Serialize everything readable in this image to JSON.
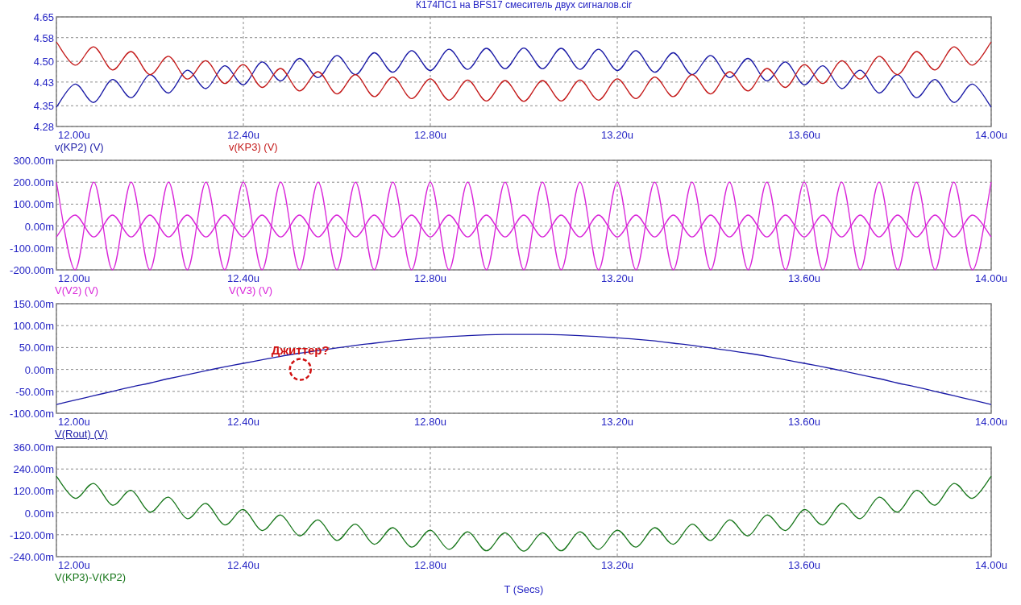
{
  "title": "К174ПС1 на BFS17 смеситель двух сигналов.cir",
  "panels": [
    {
      "chart_data": {
        "type": "line",
        "grid": true,
        "ylim": [
          4.28,
          4.65
        ],
        "xlim": [
          12,
          14
        ],
        "yticks": [
          {
            "value": 4.28,
            "label": "4.28"
          },
          {
            "value": 4.35,
            "label": "4.35"
          },
          {
            "value": 4.43,
            "label": "4.43"
          },
          {
            "value": 4.5,
            "label": "4.50"
          },
          {
            "value": 4.58,
            "label": "4.58"
          },
          {
            "value": 4.65,
            "label": "4.65"
          }
        ],
        "xticks": [
          {
            "value": 12,
            "label": "12.00u"
          },
          {
            "value": 12.4,
            "label": "12.40u"
          },
          {
            "value": 12.8,
            "label": "12.80u"
          },
          {
            "value": 13.2,
            "label": "13.20u"
          },
          {
            "value": 13.6,
            "label": "13.60u"
          },
          {
            "value": 14,
            "label": "14.00u"
          }
        ],
        "x": [
          12,
          12.04,
          12.08,
          12.12,
          12.16,
          12.2,
          12.24,
          12.28,
          12.32,
          12.36,
          12.4,
          12.44,
          12.48,
          12.52,
          12.56,
          12.6,
          12.64,
          12.68,
          12.72,
          12.76,
          12.8,
          12.84,
          12.88,
          12.92,
          12.96,
          13,
          13.04,
          13.08,
          13.12,
          13.16,
          13.2,
          13.24,
          13.28,
          13.32,
          13.36,
          13.4,
          13.44,
          13.48,
          13.52,
          13.56,
          13.6,
          13.64,
          13.68,
          13.72,
          13.76,
          13.8,
          13.84,
          13.88,
          13.92,
          13.96,
          14
        ],
        "series": [
          {
            "color": "#1a1aa6",
            "values": [
              4.345,
              4.423,
              4.361,
              4.439,
              4.377,
              4.455,
              4.393,
              4.47,
              4.408,
              4.485,
              4.421,
              4.498,
              4.434,
              4.51,
              4.445,
              4.52,
              4.455,
              4.529,
              4.463,
              4.536,
              4.469,
              4.541,
              4.473,
              4.544,
              4.475,
              4.545,
              4.475,
              4.544,
              4.473,
              4.541,
              4.469,
              4.536,
              4.463,
              4.529,
              4.455,
              4.52,
              4.445,
              4.51,
              4.434,
              4.498,
              4.421,
              4.485,
              4.408,
              4.47,
              4.393,
              4.455,
              4.377,
              4.439,
              4.361,
              4.423,
              4.345
            ]
          },
          {
            "color": "#c41a1a",
            "values": [
              4.565,
              4.487,
              4.549,
              4.471,
              4.533,
              4.455,
              4.517,
              4.44,
              4.502,
              4.425,
              4.489,
              4.412,
              4.476,
              4.4,
              4.465,
              4.39,
              4.455,
              4.381,
              4.447,
              4.374,
              4.441,
              4.369,
              4.437,
              4.366,
              4.435,
              4.365,
              4.435,
              4.366,
              4.437,
              4.369,
              4.441,
              4.374,
              4.447,
              4.381,
              4.455,
              4.39,
              4.465,
              4.4,
              4.476,
              4.412,
              4.489,
              4.425,
              4.502,
              4.44,
              4.517,
              4.455,
              4.533,
              4.471,
              4.549,
              4.487,
              4.565
            ]
          }
        ]
      },
      "legend": [
        {
          "label": "v(KP2) (V)",
          "color": "#1a1aa6",
          "selected": false
        },
        {
          "label": "v(KP3) (V)",
          "color": "#c41a1a",
          "selected": false
        }
      ]
    },
    {
      "chart_data": {
        "type": "line",
        "grid": true,
        "ylim": [
          -200,
          300
        ],
        "xlim": [
          12,
          14
        ],
        "yticks": [
          {
            "value": -200,
            "label": "-200.00m"
          },
          {
            "value": -100,
            "label": "-100.00m"
          },
          {
            "value": 0,
            "label": "0.00m"
          },
          {
            "value": 100,
            "label": "100.00m"
          },
          {
            "value": 200,
            "label": "200.00m"
          },
          {
            "value": 300,
            "label": "300.00m"
          }
        ],
        "xticks": [
          {
            "value": 12,
            "label": "12.00u"
          },
          {
            "value": 12.4,
            "label": "12.40u"
          },
          {
            "value": 12.8,
            "label": "12.80u"
          },
          {
            "value": 13.2,
            "label": "13.20u"
          },
          {
            "value": 13.6,
            "label": "13.60u"
          },
          {
            "value": 14,
            "label": "14.00u"
          }
        ],
        "x": [
          12,
          12.04,
          12.08,
          12.12,
          12.16,
          12.2,
          12.24,
          12.28,
          12.32,
          12.36,
          12.4,
          12.44,
          12.48,
          12.52,
          12.56,
          12.6,
          12.64,
          12.68,
          12.72,
          12.76,
          12.8,
          12.84,
          12.88,
          12.92,
          12.96,
          13,
          13.04,
          13.08,
          13.12,
          13.16,
          13.2,
          13.24,
          13.28,
          13.32,
          13.36,
          13.4,
          13.44,
          13.48,
          13.52,
          13.56,
          13.6,
          13.64,
          13.68,
          13.72,
          13.76,
          13.8,
          13.84,
          13.88,
          13.92,
          13.96,
          14
        ],
        "series": [
          {
            "color": "#d925d9",
            "values": [
              200,
              -200,
              200,
              -200,
              200,
              -200,
              200,
              -200,
              200,
              -200,
              200,
              -200,
              200,
              -200,
              200,
              -200,
              200,
              -200,
              200,
              -200,
              200,
              -200,
              200,
              -200,
              200,
              -200,
              200,
              -200,
              200,
              -200,
              200,
              -200,
              200,
              -200,
              200,
              -200,
              200,
              -200,
              200,
              -200,
              200,
              -200,
              200,
              -200,
              200,
              -200,
              200,
              -200,
              200,
              -200,
              200
            ]
          },
          {
            "color": "#d925d9",
            "values": [
              -50,
              50,
              -50,
              50,
              -50,
              50,
              -50,
              50,
              -50,
              50,
              -50,
              50,
              -50,
              50,
              -50,
              50,
              -50,
              50,
              -50,
              50,
              -50,
              50,
              -50,
              50,
              -50,
              50,
              -50,
              50,
              -50,
              50,
              -50,
              50,
              -50,
              50,
              -50,
              50,
              -50,
              50,
              -50,
              50,
              -50,
              50,
              -50,
              50,
              -50,
              50,
              -50,
              50,
              -50,
              50,
              -50
            ]
          }
        ]
      },
      "legend": [
        {
          "label": "V(V2) (V)",
          "color": "#d925d9",
          "selected": false
        },
        {
          "label": "V(V3) (V)",
          "color": "#d925d9",
          "selected": false
        }
      ]
    },
    {
      "chart_data": {
        "type": "line",
        "grid": true,
        "ylim": [
          -100,
          150
        ],
        "xlim": [
          12,
          14
        ],
        "yticks": [
          {
            "value": -100,
            "label": "-100.00m"
          },
          {
            "value": -50,
            "label": "-50.00m"
          },
          {
            "value": 0,
            "label": "0.00m"
          },
          {
            "value": 50,
            "label": "50.00m"
          },
          {
            "value": 100,
            "label": "100.00m"
          },
          {
            "value": 150,
            "label": "150.00m"
          }
        ],
        "xticks": [
          {
            "value": 12,
            "label": "12.00u"
          },
          {
            "value": 12.4,
            "label": "12.40u"
          },
          {
            "value": 12.8,
            "label": "12.80u"
          },
          {
            "value": 13.2,
            "label": "13.20u"
          },
          {
            "value": 13.6,
            "label": "13.60u"
          },
          {
            "value": 14,
            "label": "14.00u"
          }
        ],
        "x": [
          12,
          12.04,
          12.08,
          12.12,
          12.16,
          12.2,
          12.24,
          12.28,
          12.32,
          12.36,
          12.4,
          12.44,
          12.48,
          12.52,
          12.56,
          12.6,
          12.64,
          12.68,
          12.72,
          12.76,
          12.8,
          12.84,
          12.88,
          12.92,
          12.96,
          13,
          13.04,
          13.08,
          13.12,
          13.16,
          13.2,
          13.24,
          13.28,
          13.32,
          13.36,
          13.4,
          13.44,
          13.48,
          13.52,
          13.56,
          13.6,
          13.64,
          13.68,
          13.72,
          13.76,
          13.8,
          13.84,
          13.88,
          13.92,
          13.96,
          14
        ],
        "series": [
          {
            "color": "#1a1aa6",
            "values": [
              -80,
              -70,
              -60,
              -50,
              -40,
              -31,
              -21,
              -12,
              -3,
              6,
              14,
              22,
              30,
              37,
              43,
              49,
              55,
              60,
              65,
              69,
              72,
              75,
              77,
              79,
              80,
              80,
              80,
              79,
              77,
              75,
              72,
              69,
              65,
              60,
              55,
              49,
              43,
              37,
              30,
              22,
              14,
              6,
              -3,
              -12,
              -21,
              -31,
              -40,
              -50,
              -60,
              -70,
              -80
            ]
          }
        ],
        "annotations": [
          {
            "text": "Джиттер?",
            "x": 12.522,
            "y": 0
          }
        ]
      },
      "legend": [
        {
          "label": "V(Rout) (V)",
          "color": "#1a1aa6",
          "selected": true
        }
      ]
    },
    {
      "chart_data": {
        "type": "line",
        "grid": true,
        "ylim": [
          -240,
          360
        ],
        "xlim": [
          12,
          14
        ],
        "yticks": [
          {
            "value": -240,
            "label": "-240.00m"
          },
          {
            "value": -120,
            "label": "-120.00m"
          },
          {
            "value": 0,
            "label": "0.00m"
          },
          {
            "value": 120,
            "label": "120.00m"
          },
          {
            "value": 240,
            "label": "240.00m"
          },
          {
            "value": 360,
            "label": "360.00m"
          }
        ],
        "xticks": [
          {
            "value": 12,
            "label": "12.00u"
          },
          {
            "value": 12.4,
            "label": "12.40u"
          },
          {
            "value": 12.8,
            "label": "12.80u"
          },
          {
            "value": 13.2,
            "label": "13.20u"
          },
          {
            "value": 13.6,
            "label": "13.60u"
          },
          {
            "value": 14,
            "label": "14.00u"
          }
        ],
        "x": [
          12,
          12.04,
          12.08,
          12.12,
          12.16,
          12.2,
          12.24,
          12.28,
          12.32,
          12.36,
          12.4,
          12.44,
          12.48,
          12.52,
          12.56,
          12.6,
          12.64,
          12.68,
          12.72,
          12.76,
          12.8,
          12.84,
          12.88,
          12.92,
          12.96,
          13,
          13.04,
          13.08,
          13.12,
          13.16,
          13.2,
          13.24,
          13.28,
          13.32,
          13.36,
          13.4,
          13.44,
          13.48,
          13.52,
          13.56,
          13.6,
          13.64,
          13.68,
          13.72,
          13.76,
          13.8,
          13.84,
          13.88,
          13.92,
          13.96,
          14
        ],
        "series": [
          {
            "color": "#17761a",
            "values": [
              200,
              80,
              161,
              42,
              123,
              4,
              86,
              -32,
              51,
              -66,
              18,
              -97,
              -12,
              -126,
              -39,
              -151,
              -62,
              -172,
              -81,
              -188,
              -95,
              -200,
              -104,
              -208,
              -109,
              -210,
              -109,
              -208,
              -104,
              -200,
              -95,
              -188,
              -81,
              -172,
              -62,
              -151,
              -39,
              -126,
              -12,
              -97,
              18,
              -66,
              51,
              -32,
              86,
              4,
              123,
              42,
              161,
              80,
              200
            ]
          }
        ]
      },
      "legend": [
        {
          "label": "V(KP3)-V(KP2)",
          "color": "#17761a",
          "selected": false
        }
      ]
    }
  ],
  "x_axis_label": "T (Secs)"
}
